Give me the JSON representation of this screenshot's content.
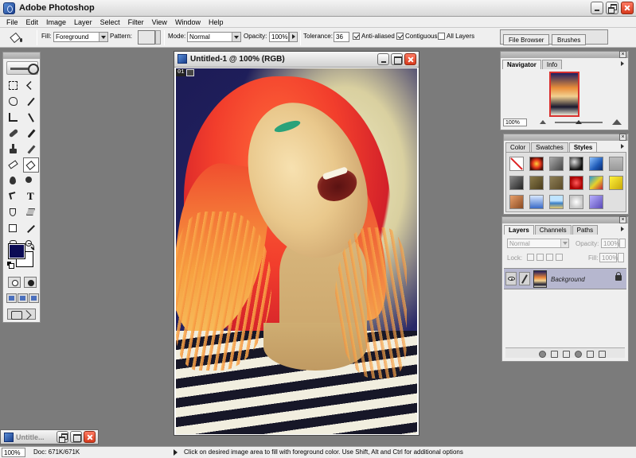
{
  "app": {
    "title": "Adobe Photoshop"
  },
  "menu": [
    "File",
    "Edit",
    "Image",
    "Layer",
    "Select",
    "Filter",
    "View",
    "Window",
    "Help"
  ],
  "options_bar": {
    "fill_label": "Fill:",
    "fill_value": "Foreground",
    "pattern_label": "Pattern:",
    "mode_label": "Mode:",
    "mode_value": "Normal",
    "opacity_label": "Opacity:",
    "opacity_value": "100%",
    "tolerance_label": "Tolerance:",
    "tolerance_value": "36",
    "anti_aliased_label": "Anti-aliased",
    "anti_aliased_checked": true,
    "contiguous_label": "Contiguous",
    "contiguous_checked": true,
    "all_layers_label": "All Layers",
    "all_layers_checked": false
  },
  "palette_well": {
    "tabs": [
      "File Browser",
      "Brushes"
    ]
  },
  "toolbox": {
    "foreground_color": "#0c0c55",
    "background_color": "#ffffff",
    "tools": [
      "marquee-icon",
      "move-icon",
      "lasso-icon",
      "magic-wand-icon",
      "crop-icon",
      "slice-icon",
      "healing-brush-icon",
      "brush-icon",
      "clone-stamp-icon",
      "history-brush-icon",
      "eraser-icon",
      "paint-bucket-icon",
      "blur-icon",
      "dodge-icon",
      "path-selection-icon",
      "type-icon",
      "pen-icon",
      "custom-shape-icon",
      "notes-icon",
      "eyedropper-icon",
      "hand-icon",
      "zoom-icon"
    ],
    "active_tool": "paint-bucket-icon",
    "type_glyph": "T"
  },
  "document": {
    "title": "Untitled-1 @ 100% (RGB)",
    "badge": "01"
  },
  "navigator": {
    "tabs": [
      "Navigator",
      "Info"
    ],
    "active_tab": "Navigator",
    "zoom": "100%",
    "zoom_slider_level": 0.5
  },
  "color_palette": {
    "tabs": [
      "Color",
      "Swatches",
      "Styles"
    ],
    "active_tab": "Styles",
    "styles": [
      {
        "name": "none-style-icon"
      },
      {
        "bg": "radial-gradient(circle,#ffd23a 0%,#e2341a 45%,#4a0f08 80%)"
      },
      {
        "bg": "linear-gradient(135deg,#aaa,#444)"
      },
      {
        "bg": "radial-gradient(circle at 35% 35%,#ddd,#111 70%)"
      },
      {
        "bg": "linear-gradient(135deg,#8fc3ff,#1f5bb8 60%,#0c2c6c)"
      },
      {
        "bg": "linear-gradient(#bdbdbd,#9a9a9a)"
      },
      {
        "bg": "linear-gradient(135deg,#888,#222)"
      },
      {
        "bg": "linear-gradient(135deg,#8a7b4a,#4a3c1c)"
      },
      {
        "bg": "linear-gradient(135deg,#8e7f56,#5a4a28)"
      },
      {
        "bg": "radial-gradient(circle,#ff5a5a,#a00 70%)"
      },
      {
        "bg": "linear-gradient(135deg,#2a9ad8 0%,#e6d12a 50%,#c21f3a 100%)"
      },
      {
        "bg": "linear-gradient(135deg,#fff23a,#c8a80a)"
      },
      {
        "bg": "linear-gradient(135deg,#e9a06a,#8a4a22)"
      },
      {
        "bg": "linear-gradient(#d8e8ff,#3a6ac8)"
      },
      {
        "bg": "linear-gradient(#bfe4ff 40%,#3a80c8 60%,#e6c86a)"
      },
      {
        "bg": "radial-gradient(circle,#fff,#c8c8c8 70%)"
      },
      {
        "bg": "linear-gradient(135deg,#b8b0ff,#5a4ab8)"
      }
    ]
  },
  "layers": {
    "tabs": [
      "Layers",
      "Channels",
      "Paths"
    ],
    "active_tab": "Layers",
    "blend_mode": "Normal",
    "opacity_label": "Opacity:",
    "opacity_value": "100%",
    "lock_label": "Lock:",
    "fill_label": "Fill:",
    "fill_value": "100%",
    "items": [
      {
        "name": "Background",
        "visible": true,
        "locked": true
      }
    ]
  },
  "minimized_window": {
    "title": "Untitle..."
  },
  "status_bar": {
    "zoom": "100%",
    "doc_size": "Doc: 671K/671K",
    "hint": "Click on desired image area to fill with foreground color.  Use Shift, Alt and Ctrl for additional options"
  }
}
